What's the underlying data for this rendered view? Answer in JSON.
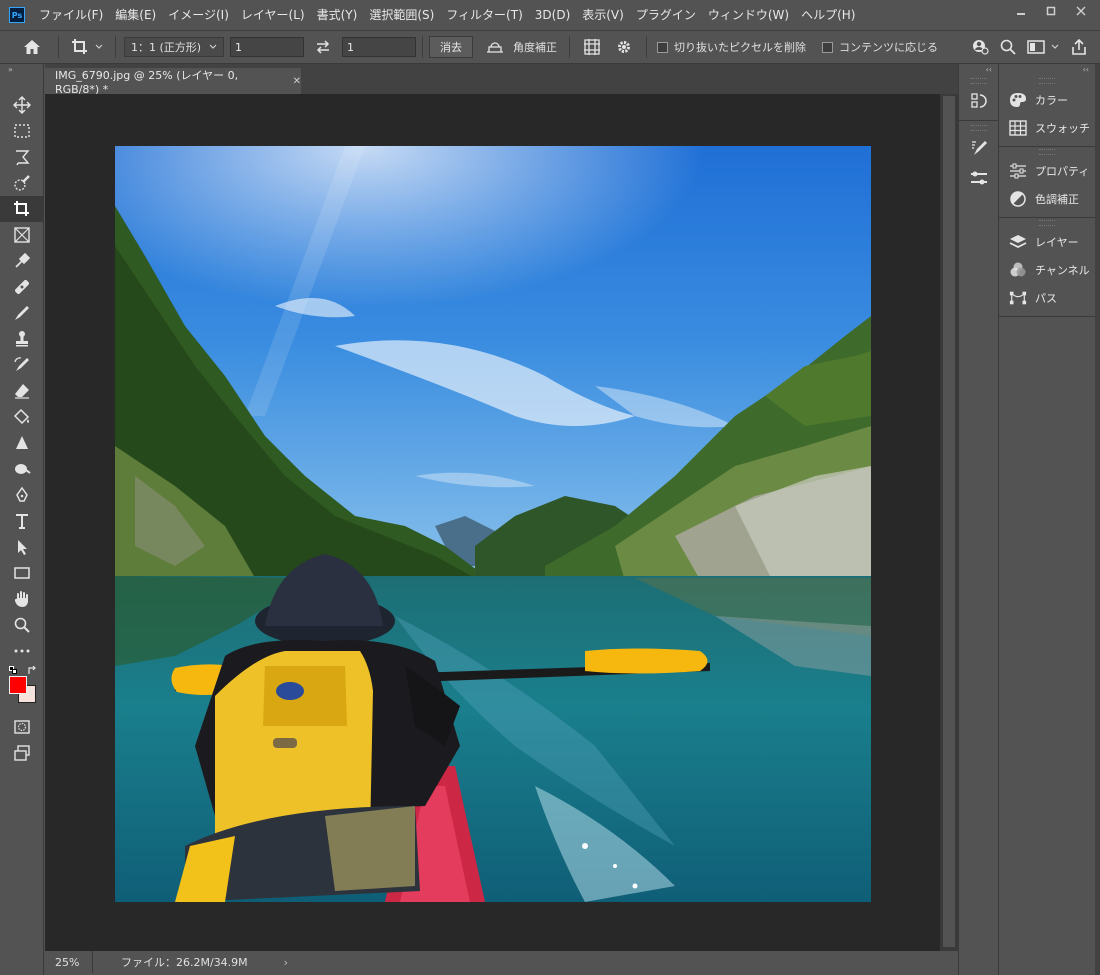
{
  "app": {
    "logo_text": "Ps",
    "menu": [
      "ファイル(F)",
      "編集(E)",
      "イメージ(I)",
      "レイヤー(L)",
      "書式(Y)",
      "選択範囲(S)",
      "フィルター(T)",
      "3D(D)",
      "表示(V)",
      "プラグイン",
      "ウィンドウ(W)",
      "ヘルプ(H)"
    ],
    "window_controls": [
      "minimize",
      "restore",
      "close"
    ]
  },
  "options_bar": {
    "ratio_select": "1：1 (正方形)",
    "width_value": "1",
    "height_value": "1",
    "clear_label": "消去",
    "straighten_label": "角度補正",
    "delete_cropped_label": "切り抜いたピクセルを削除",
    "delete_cropped_checked": false,
    "content_aware_label": "コンテンツに応じる",
    "content_aware_checked": false
  },
  "document": {
    "tab_title": "IMG_6790.jpg @ 25% (レイヤー 0, RGB/8*) *",
    "zoom": "25%",
    "file_info": "ファイル：26.2M/34.9M"
  },
  "tools": [
    {
      "name": "move-tool",
      "icon": "move-icon"
    },
    {
      "name": "marquee-tool",
      "icon": "marquee-icon"
    },
    {
      "name": "lasso-tool",
      "icon": "lasso-icon"
    },
    {
      "name": "quick-select-tool",
      "icon": "quick-select-icon"
    },
    {
      "name": "crop-tool",
      "icon": "crop-icon",
      "active": true
    },
    {
      "name": "frame-tool",
      "icon": "frame-icon"
    },
    {
      "name": "eyedropper-tool",
      "icon": "eyedropper-icon"
    },
    {
      "name": "healing-tool",
      "icon": "bandage-icon"
    },
    {
      "name": "brush-tool",
      "icon": "brush-icon"
    },
    {
      "name": "stamp-tool",
      "icon": "stamp-icon"
    },
    {
      "name": "history-brush-tool",
      "icon": "history-brush-icon"
    },
    {
      "name": "eraser-tool",
      "icon": "eraser-icon"
    },
    {
      "name": "paint-bucket-tool",
      "icon": "paint-bucket-icon"
    },
    {
      "name": "blur-tool",
      "icon": "blur-icon"
    },
    {
      "name": "dodge-tool",
      "icon": "dodge-icon"
    },
    {
      "name": "pen-tool",
      "icon": "pen-icon"
    },
    {
      "name": "type-tool",
      "icon": "type-icon"
    },
    {
      "name": "path-select-tool",
      "icon": "arrow-icon"
    },
    {
      "name": "rectangle-tool",
      "icon": "rectangle-icon"
    },
    {
      "name": "hand-tool",
      "icon": "hand-icon"
    },
    {
      "name": "zoom-tool",
      "icon": "zoom-icon"
    },
    {
      "name": "more-tools",
      "icon": "ellipsis-icon"
    }
  ],
  "colors": {
    "foreground": "#ff0000",
    "background": "#f6e2dc",
    "canvas_bg": "#282828",
    "panel_bg": "#535353"
  },
  "panels": {
    "group1": [
      {
        "label": "カラー",
        "icon": "palette-icon"
      },
      {
        "label": "スウォッチ",
        "icon": "swatches-icon"
      }
    ],
    "group2": [
      {
        "label": "プロパティ",
        "icon": "sliders-icon"
      },
      {
        "label": "色調補正",
        "icon": "adjustment-icon"
      }
    ],
    "group3": [
      {
        "label": "レイヤー",
        "icon": "layers-icon"
      },
      {
        "label": "チャンネル",
        "icon": "channels-icon"
      },
      {
        "label": "パス",
        "icon": "paths-icon"
      }
    ]
  }
}
